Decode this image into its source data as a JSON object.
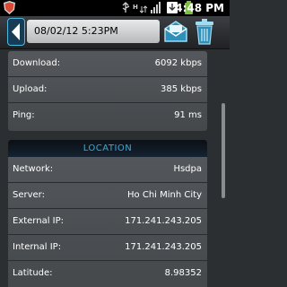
{
  "status_bar": {
    "time": "4:48 PM",
    "icons": [
      "shield-icon",
      "usb-icon",
      "network-type-icon",
      "download-icon",
      "battery-icon"
    ]
  },
  "header": {
    "date": "08/02/12 5:23PM",
    "icons": [
      "back-arrow-icon",
      "mail-icon",
      "trash-icon"
    ]
  },
  "speed": {
    "rows": [
      {
        "label": "Download:",
        "value": "6092 kbps"
      },
      {
        "label": "Upload:",
        "value": "385 kbps"
      },
      {
        "label": "Ping:",
        "value": "91 ms"
      }
    ]
  },
  "location": {
    "heading": "LOCATION",
    "rows": [
      {
        "label": "Network:",
        "value": "Hsdpa"
      },
      {
        "label": "Server:",
        "value": "Ho Chi Minh City"
      },
      {
        "label": "External IP:",
        "value": "171.241.243.205"
      },
      {
        "label": "Internal IP:",
        "value": "171.241.243.205"
      },
      {
        "label": "Latitude:",
        "value": "8.98352"
      }
    ]
  },
  "colors": {
    "accent": "#3fa9d6",
    "background": "#2c2f32",
    "card": "#505356"
  }
}
